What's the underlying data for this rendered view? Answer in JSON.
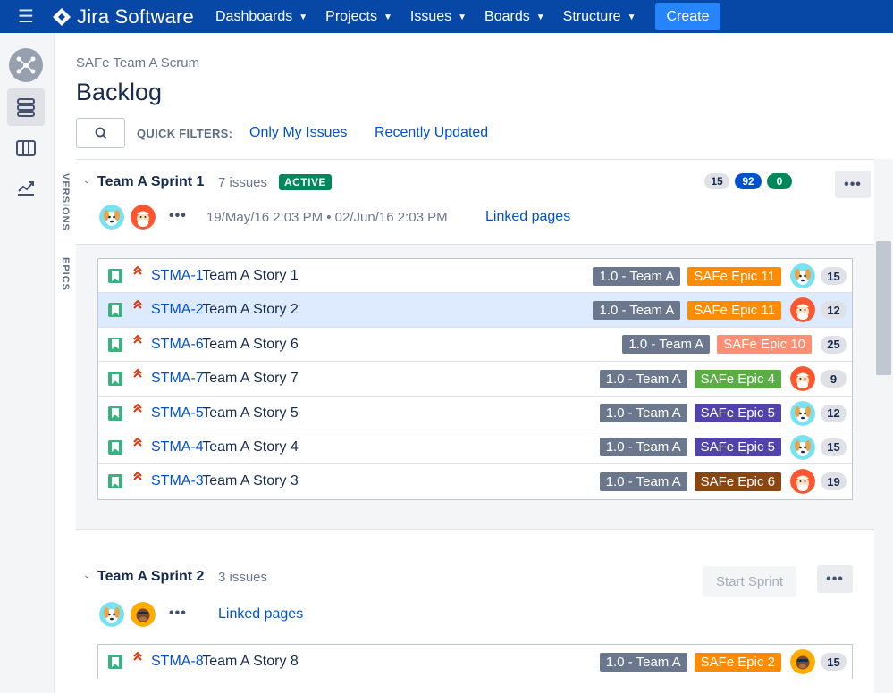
{
  "topnav": {
    "brand": "Jira Software",
    "items": [
      {
        "label": "Dashboards"
      },
      {
        "label": "Projects"
      },
      {
        "label": "Issues"
      },
      {
        "label": "Boards"
      },
      {
        "label": "Structure"
      }
    ],
    "create_label": "Create",
    "colors": {
      "bar": "#0747a6",
      "create": "#2684ff"
    }
  },
  "sidebar": {
    "items": [
      {
        "icon": "project-avatar-icon"
      },
      {
        "icon": "backlog-icon",
        "active": true
      },
      {
        "icon": "board-columns-icon"
      },
      {
        "icon": "reports-icon"
      }
    ],
    "vertical_tabs": [
      "VERSIONS",
      "EPICS"
    ]
  },
  "header": {
    "breadcrumb": "SAFe Team A Scrum",
    "title": "Backlog",
    "quick_filters_label": "QUICK FILTERS:",
    "quick_filters": [
      "Only My Issues",
      "Recently Updated"
    ]
  },
  "sprints": [
    {
      "name": "Team A Sprint 1",
      "issue_count": "7 issues",
      "status": "ACTIVE",
      "counts": [
        {
          "value": "15",
          "color": "#dfe1e6",
          "text_color": "#172b4d"
        },
        {
          "value": "92",
          "color": "#0052cc",
          "text_color": "#ffffff"
        },
        {
          "value": "0",
          "color": "#00875a",
          "text_color": "#ffffff"
        }
      ],
      "dates": "19/May/16 2:03 PM • 02/Jun/16 2:03 PM",
      "linked_pages": "Linked pages",
      "issues": [
        {
          "key": "STMA-1",
          "summary": "Team A Story 1",
          "version": "1.0 - Team A",
          "epic": "SAFe Epic 11",
          "epic_color": "#ff8b00",
          "assignee": "dog-avatar",
          "estimate": "15",
          "selected": false
        },
        {
          "key": "STMA-2",
          "summary": "Team A Story 2",
          "version": "1.0 - Team A",
          "epic": "SAFe Epic 11",
          "epic_color": "#ff8b00",
          "assignee": "santa-avatar",
          "estimate": "12",
          "selected": true
        },
        {
          "key": "STMA-6",
          "summary": "Team A Story 6",
          "version": "1.0 - Team A",
          "epic": "SAFe Epic 10",
          "epic_color": "#ff8f73",
          "assignee": "",
          "estimate": "25",
          "selected": false
        },
        {
          "key": "STMA-7",
          "summary": "Team A Story 7",
          "version": "1.0 - Team A",
          "epic": "SAFe Epic 4",
          "epic_color": "#5aac44",
          "assignee": "santa-avatar",
          "estimate": "9",
          "selected": false
        },
        {
          "key": "STMA-5",
          "summary": "Team A Story 5",
          "version": "1.0 - Team A",
          "epic": "SAFe Epic 5",
          "epic_color": "#5243aa",
          "assignee": "dog-avatar",
          "estimate": "12",
          "selected": false
        },
        {
          "key": "STMA-4",
          "summary": "Team A Story 4",
          "version": "1.0 - Team A",
          "epic": "SAFe Epic 5",
          "epic_color": "#5243aa",
          "assignee": "dog-avatar",
          "estimate": "15",
          "selected": false
        },
        {
          "key": "STMA-3",
          "summary": "Team A Story 3",
          "version": "1.0 - Team A",
          "epic": "SAFe Epic 6",
          "epic_color": "#8b4513",
          "assignee": "santa-avatar",
          "estimate": "19",
          "selected": false
        }
      ]
    },
    {
      "name": "Team A Sprint 2",
      "issue_count": "3 issues",
      "start_label": "Start Sprint",
      "linked_pages": "Linked pages",
      "issues": [
        {
          "key": "STMA-8",
          "summary": "Team A Story 8",
          "version": "1.0 - Team A",
          "epic": "SAFe Epic 2",
          "epic_color": "#ff8b00",
          "assignee": "bear-avatar",
          "estimate": "15",
          "selected": false
        }
      ]
    }
  ]
}
